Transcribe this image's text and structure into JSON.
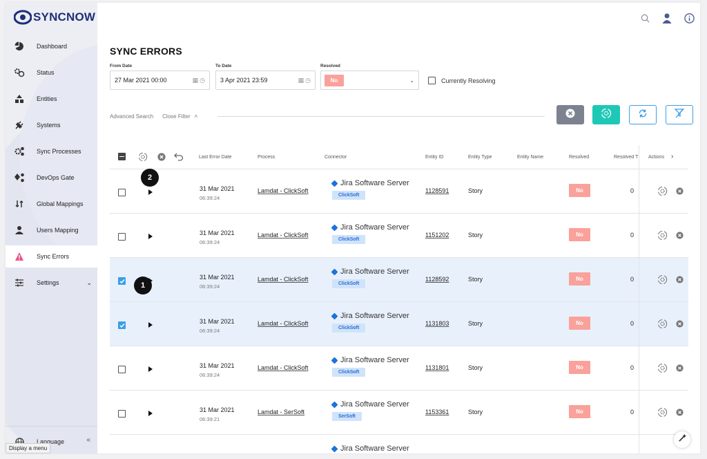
{
  "app": {
    "logo_text": "SYNCNOW"
  },
  "sidebar": {
    "items": [
      {
        "label": "Dashboard",
        "icon": "pie-chart-icon"
      },
      {
        "label": "Status",
        "icon": "gears-icon"
      },
      {
        "label": "Entities",
        "icon": "shapes-icon"
      },
      {
        "label": "Systems",
        "icon": "plug-icon"
      },
      {
        "label": "Sync Processes",
        "icon": "cogs-icon"
      },
      {
        "label": "DevOps Gate",
        "icon": "gate-icon"
      },
      {
        "label": "Global Mappings",
        "icon": "sync-arrows-icon"
      },
      {
        "label": "Users Mapping",
        "icon": "user-icon"
      },
      {
        "label": "Sync Errors",
        "icon": "warning-icon",
        "active": true
      },
      {
        "label": "Settings",
        "icon": "sliders-icon"
      }
    ],
    "language_label": "Language",
    "tooltip": "Display a menu"
  },
  "page": {
    "title": "SYNC ERRORS"
  },
  "filters": {
    "from_label": "From Date",
    "from_value": "27 Mar 2021 00:00",
    "to_label": "To Date",
    "to_value": "3 Apr 2021 23:59",
    "resolved_label": "Resolved",
    "resolved_value": "No",
    "currently_resolving": "Currently Resolving",
    "advanced_search": "Advanced Search",
    "close_filter": "Close Filter"
  },
  "table": {
    "columns": [
      "Last Error Date",
      "Process",
      "Connector",
      "Entity ID",
      "Entity Type",
      "Entity Name",
      "Resolved",
      "Resolved T",
      "Actions"
    ],
    "rows": [
      {
        "date": "31 Mar 2021",
        "time": "06:39:24",
        "process": "Lamdat - ClickSoft",
        "connector": "Jira Software Server",
        "tag": "ClickSoft",
        "entity_id": "1128591",
        "entity_type": "Story",
        "resolved": "No",
        "resolved_t": "0",
        "checked": false
      },
      {
        "date": "31 Mar 2021",
        "time": "06:39:24",
        "process": "Lamdat - ClickSoft",
        "connector": "Jira Software Server",
        "tag": "ClickSoft",
        "entity_id": "1151202",
        "entity_type": "Story",
        "resolved": "No",
        "resolved_t": "0",
        "checked": false
      },
      {
        "date": "31 Mar 2021",
        "time": "06:39:24",
        "process": "Lamdat - ClickSoft",
        "connector": "Jira Software Server",
        "tag": "ClickSoft",
        "entity_id": "1128592",
        "entity_type": "Story",
        "resolved": "No",
        "resolved_t": "0",
        "checked": true
      },
      {
        "date": "31 Mar 2021",
        "time": "06:39:24",
        "process": "Lamdat - ClickSoft",
        "connector": "Jira Software Server",
        "tag": "ClickSoft",
        "entity_id": "1131803",
        "entity_type": "Story",
        "resolved": "No",
        "resolved_t": "0",
        "checked": true
      },
      {
        "date": "31 Mar 2021",
        "time": "06:39:24",
        "process": "Lamdat - ClickSoft",
        "connector": "Jira Software Server",
        "tag": "ClickSoft",
        "entity_id": "1131801",
        "entity_type": "Story",
        "resolved": "No",
        "resolved_t": "0",
        "checked": false
      },
      {
        "date": "31 Mar 2021",
        "time": "06:39:21",
        "process": "Lamdat - SerSoft",
        "connector": "Jira Software Server",
        "tag": "SerSoft",
        "entity_id": "1153361",
        "entity_type": "Story",
        "resolved": "No",
        "resolved_t": "0",
        "checked": false
      },
      {
        "date": "",
        "time": "",
        "process": "",
        "connector": "Jira Software Server",
        "tag": "",
        "entity_id": "",
        "entity_type": "",
        "resolved": "",
        "resolved_t": "",
        "checked": false
      }
    ]
  },
  "markers": {
    "one": "1",
    "two": "2"
  },
  "colors": {
    "brand": "#1f2f78",
    "accent": "#1ec8b6",
    "danger": "#e94f8a",
    "no_badge": "#f9a19a"
  }
}
